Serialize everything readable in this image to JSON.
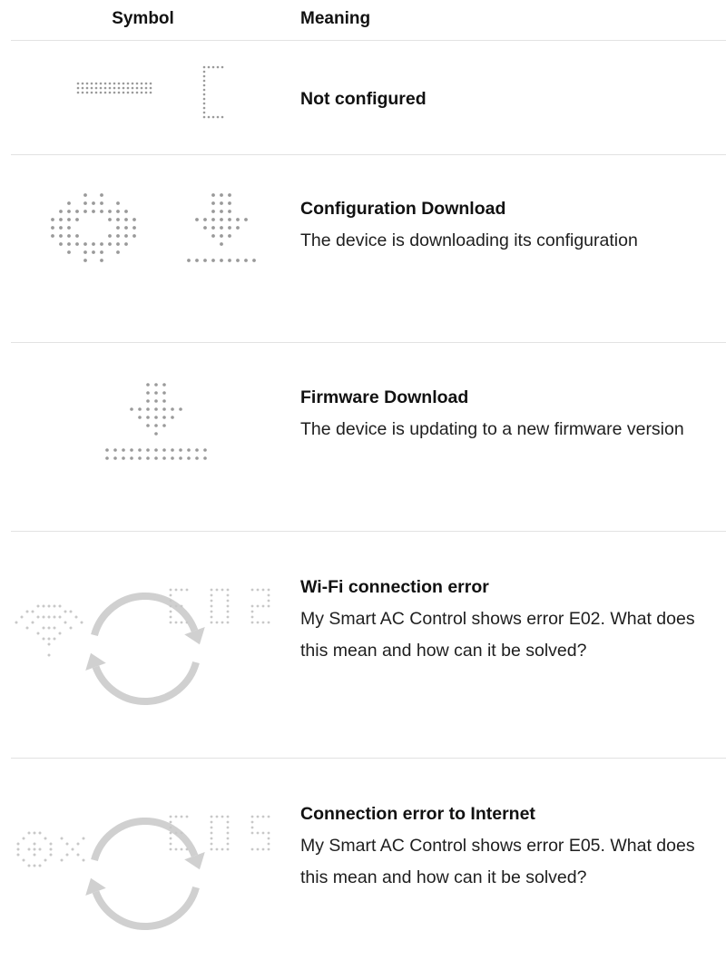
{
  "table": {
    "header_symbol": "Symbol",
    "header_meaning": "Meaning"
  },
  "rows": [
    {
      "title": "Not configured",
      "description": "",
      "icon": "not-configured-dot-icon"
    },
    {
      "title": "Configuration Download",
      "description": "The device is downloading its configuration",
      "icon": "gear-download-dot-icon"
    },
    {
      "title": "Firmware Download",
      "description": "The device is updating to a new firmware version",
      "icon": "download-arrow-dot-icon"
    },
    {
      "title": "Wi-Fi connection error",
      "description": "My Smart AC Control shows error E02. What does this mean and how can it be solved?",
      "icon": "wifi-error-e02-icon",
      "display_text": "E02"
    },
    {
      "title": "Connection error to Internet",
      "description": "My Smart AC Control shows error E05. What does this mean and how can it be solved?",
      "icon": "internet-error-e05-icon",
      "display_text": "E05"
    }
  ],
  "colors": {
    "dot": "#9a9a9a",
    "dot_light": "#c8c8c8",
    "arrow": "#d0d0d0",
    "divider": "#e2e2e2"
  }
}
